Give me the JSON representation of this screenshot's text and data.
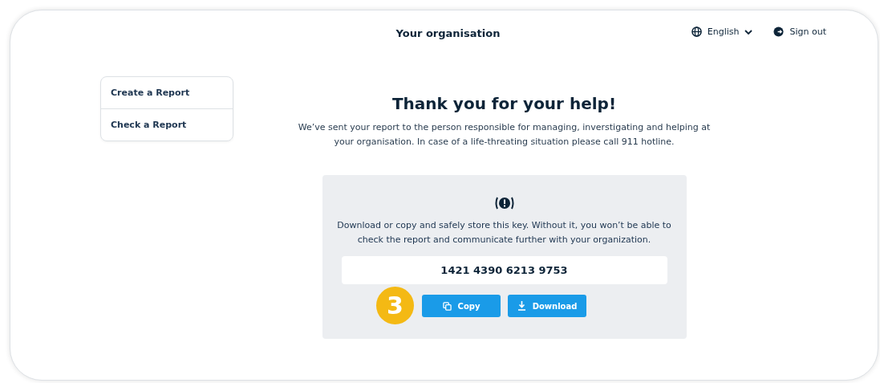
{
  "header": {
    "title": "Your organisation",
    "language": "English",
    "sign_out": "Sign out"
  },
  "sidebar": {
    "items": [
      {
        "label": "Create a Report"
      },
      {
        "label": "Check a Report"
      }
    ]
  },
  "main": {
    "heading": "Thank you for your help!",
    "message": "We’ve sent your report to the person responsible for managing, inverstigating and helping at your organisation. In case of a life-threating situation please call 911 hotline.",
    "key_panel": {
      "warning": "Download or copy and safely store this key. Without it, you won’t be able to check the report and communicate further with your organization.",
      "key": "1421 4390 6213 9753",
      "step_badge": "3",
      "buttons": [
        {
          "kind": "copy",
          "label": "Copy"
        },
        {
          "kind": "download",
          "label": "Download"
        }
      ]
    }
  }
}
